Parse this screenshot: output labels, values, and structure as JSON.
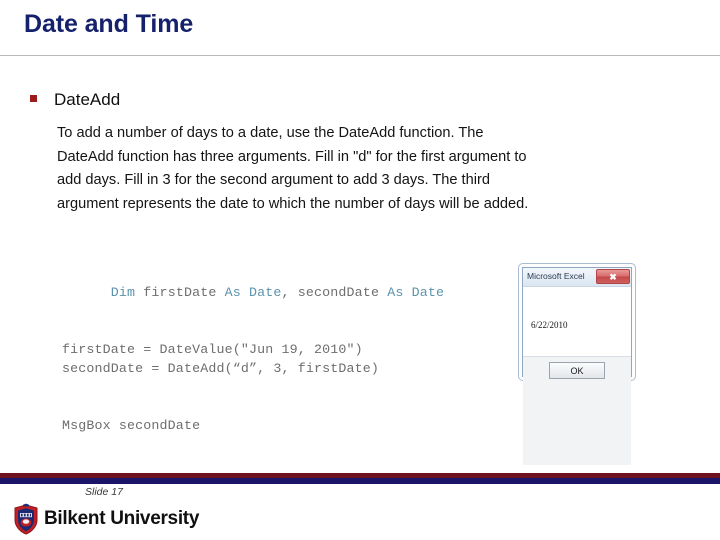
{
  "slide": {
    "title": "Date and Time",
    "bullet": {
      "marker": "square-bullet",
      "label": "DateAdd"
    },
    "body_lines": [
      "To add a number of days to a date, use the DateAdd function. The",
      "DateAdd function has three arguments. Fill in \"d\" for the first argument to",
      "add days. Fill in 3 for the second argument to add 3 days. The third",
      "argument represents the date to which the number of days will be added."
    ],
    "code": {
      "line1_parts": [
        {
          "text": "Dim",
          "kind": "keyword"
        },
        {
          "text": " firstDate ",
          "kind": "plain"
        },
        {
          "text": "As Date",
          "kind": "keyword"
        },
        {
          "text": ", secondDate ",
          "kind": "plain"
        },
        {
          "text": "As Date",
          "kind": "keyword"
        }
      ],
      "line2": "firstDate = DateValue(\"Jun 19, 2010\")",
      "line3": "secondDate = DateAdd(“d”, 3, firstDate)",
      "line4": "MsgBox secondDate"
    },
    "msgbox": {
      "title": "Microsoft Excel",
      "close_label": "✖",
      "message": "6/22/2010",
      "ok_label": "OK"
    },
    "footer": {
      "slide_number": "Slide 17",
      "brand": "Bilkent University",
      "crest": "bilkent-crest"
    },
    "colors": {
      "title_navy": "#16216b",
      "bullet_red": "#9e1b1b",
      "code_gray": "#6e6e6e",
      "code_keyword_blue": "#5b93ad",
      "bar_red": "#6e1220",
      "bar_navy": "#1b1468"
    }
  }
}
